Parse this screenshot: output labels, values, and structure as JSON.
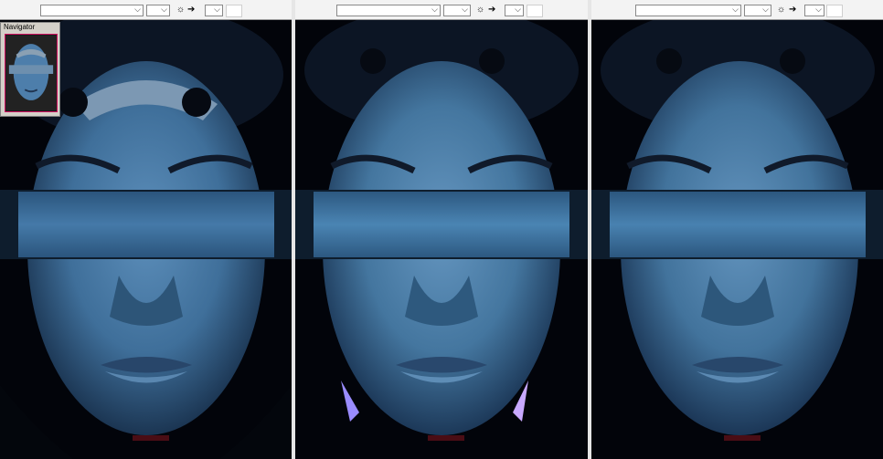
{
  "navigator": {
    "title": "Navigator"
  },
  "panes": [
    {
      "id": "left",
      "dropdown_value": "",
      "small_dropdown_value": "",
      "zoom_dropdown_value": ""
    },
    {
      "id": "middle",
      "dropdown_value": "",
      "small_dropdown_value": "",
      "zoom_dropdown_value": ""
    },
    {
      "id": "right",
      "dropdown_value": "",
      "small_dropdown_value": "",
      "zoom_dropdown_value": ""
    }
  ],
  "icons": {
    "brightness": "brightness-icon",
    "arrow": "arrow-right-icon",
    "chevron": "chevron-down-icon"
  },
  "colors": {
    "uv_skin": "#3f6f9a",
    "background": "#000000",
    "navigator_frame": "#d01060"
  }
}
